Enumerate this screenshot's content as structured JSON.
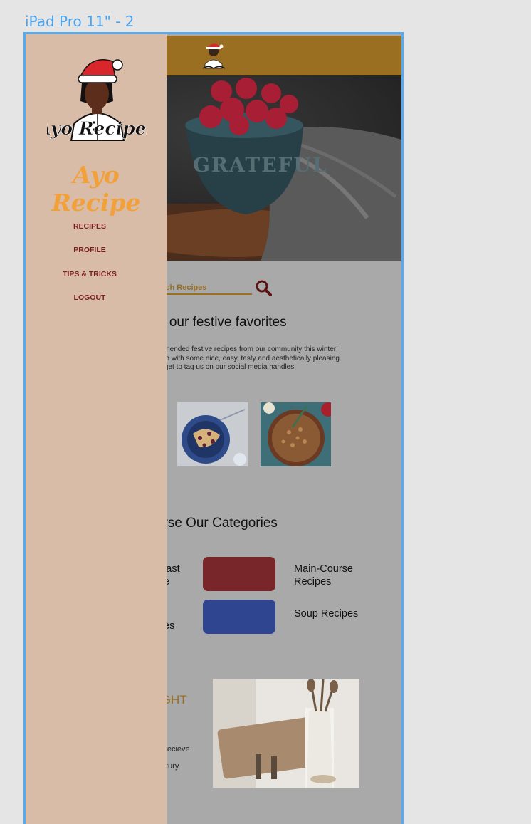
{
  "frame_label": "iPad Pro 11\" - 2",
  "search": {
    "placeholder_visible": "arch Recipes"
  },
  "festive": {
    "title": "e our festive favorites",
    "desc_lines": [
      "mmended festive recipes from our community this winter!",
      "son with some nice, easy, tasty and aesthetically pleasing",
      "orget to tag us on our social media handles."
    ]
  },
  "categories": {
    "title": "wse Our Categories",
    "left_labels": [
      "kfast",
      "pe",
      "k",
      "pes"
    ],
    "items": [
      {
        "label_lines": [
          "Main-Course",
          "Recipes"
        ],
        "color": "#782629"
      },
      {
        "label_lines": [
          "Soup Recipes"
        ],
        "color": "#304590"
      }
    ]
  },
  "newsletter": {
    "line1": "IGHT",
    "line2": "?",
    "body1": "d recieve",
    "body2": "luxury"
  },
  "drawer": {
    "brand": "Ayo Recipe",
    "logo_text": "Ayo Recipes",
    "nav": [
      "RECIPES",
      "PROFILE",
      "TIPS & TRICKS",
      "LOGOUT"
    ]
  },
  "colors": {
    "accent": "#9a6f22",
    "drawer_bg": "#d9bca8",
    "brand": "#f2a03a",
    "nav_text": "#7a1f1f",
    "frame_outline": "#55aaf2"
  }
}
